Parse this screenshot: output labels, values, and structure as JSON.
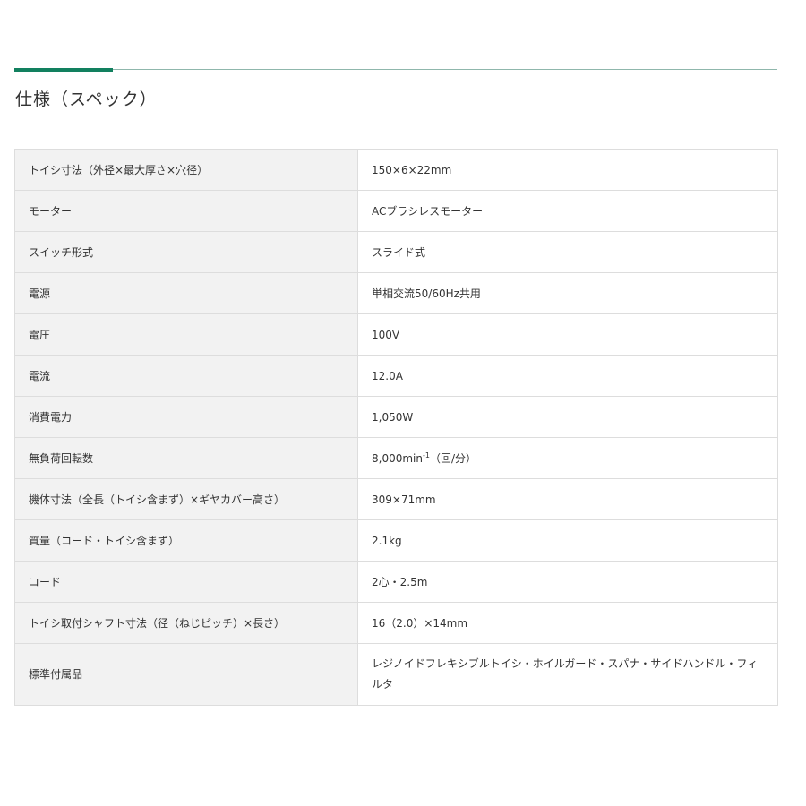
{
  "section": {
    "title": "仕様（スペック）"
  },
  "specs": [
    {
      "label": "トイシ寸法（外径×最大厚さ×穴径）",
      "value": "150×6×22mm"
    },
    {
      "label": "モーター",
      "value": "ACブラシレスモーター"
    },
    {
      "label": "スイッチ形式",
      "value": "スライド式"
    },
    {
      "label": "電源",
      "value": "単相交流50/60Hz共用"
    },
    {
      "label": "電圧",
      "value": "100V"
    },
    {
      "label": "電流",
      "value": "12.0A"
    },
    {
      "label": "消費電力",
      "value": "1,050W"
    },
    {
      "label": "無負荷回転数",
      "value_main": "8,000min",
      "value_sup": "-1",
      "value_suffix": "（回/分）"
    },
    {
      "label": "機体寸法（全長（トイシ含まず）×ギヤカバー高さ）",
      "value": "309×71mm"
    },
    {
      "label": "質量（コード・トイシ含まず）",
      "value": "2.1kg"
    },
    {
      "label": "コード",
      "value": "2心・2.5m"
    },
    {
      "label": "トイシ取付シャフト寸法（径（ねじピッチ）×長さ）",
      "value": "16（2.0）×14mm"
    },
    {
      "label": "標準付属品",
      "value": "レジノイドフレキシブルトイシ・ホイルガード・スパナ・サイドハンドル・フィルタ"
    }
  ]
}
